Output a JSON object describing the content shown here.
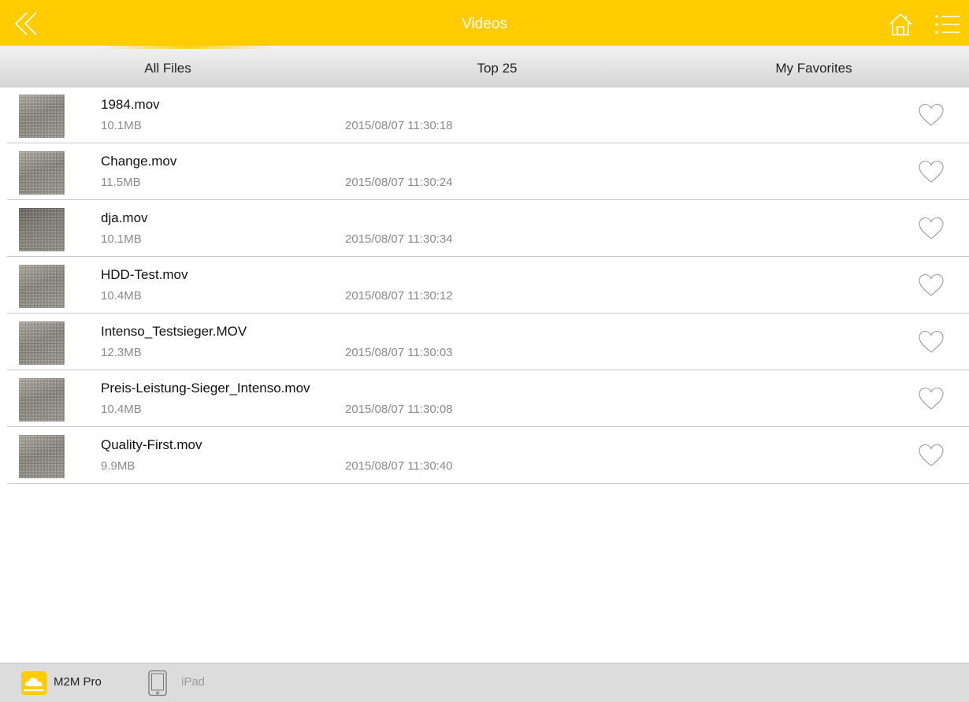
{
  "header": {
    "title": "Videos",
    "back_icon": "double-chevron-left-icon",
    "home_icon": "home-icon",
    "menu_icon": "list-menu-icon",
    "accent_color": "#ffcc00"
  },
  "tabs": [
    {
      "label": "All Files",
      "active": true
    },
    {
      "label": "Top 25",
      "active": false
    },
    {
      "label": "My Favorites",
      "active": false
    }
  ],
  "files": [
    {
      "name": "1984.mov",
      "size": "10.1MB",
      "date": "2015/08/07 11:30:18",
      "favorite": false
    },
    {
      "name": "Change.mov",
      "size": "11.5MB",
      "date": "2015/08/07 11:30:24",
      "favorite": false
    },
    {
      "name": "dja.mov",
      "size": "10.1MB",
      "date": "2015/08/07 11:30:34",
      "favorite": false
    },
    {
      "name": "HDD-Test.mov",
      "size": "10.4MB",
      "date": "2015/08/07 11:30:12",
      "favorite": false
    },
    {
      "name": "Intenso_Testsieger.MOV",
      "size": "12.3MB",
      "date": "2015/08/07 11:30:03",
      "favorite": false
    },
    {
      "name": "Preis-Leistung-Sieger_Intenso.mov",
      "size": "10.4MB",
      "date": "2015/08/07 11:30:08",
      "favorite": false
    },
    {
      "name": "Quality-First.mov",
      "size": "9.9MB",
      "date": "2015/08/07 11:30:40",
      "favorite": false
    }
  ],
  "footer": {
    "sources": [
      {
        "label": "M2M Pro",
        "icon": "cloud-drive-icon",
        "active": true
      },
      {
        "label": "iPad",
        "icon": "tablet-icon",
        "active": false
      }
    ]
  }
}
